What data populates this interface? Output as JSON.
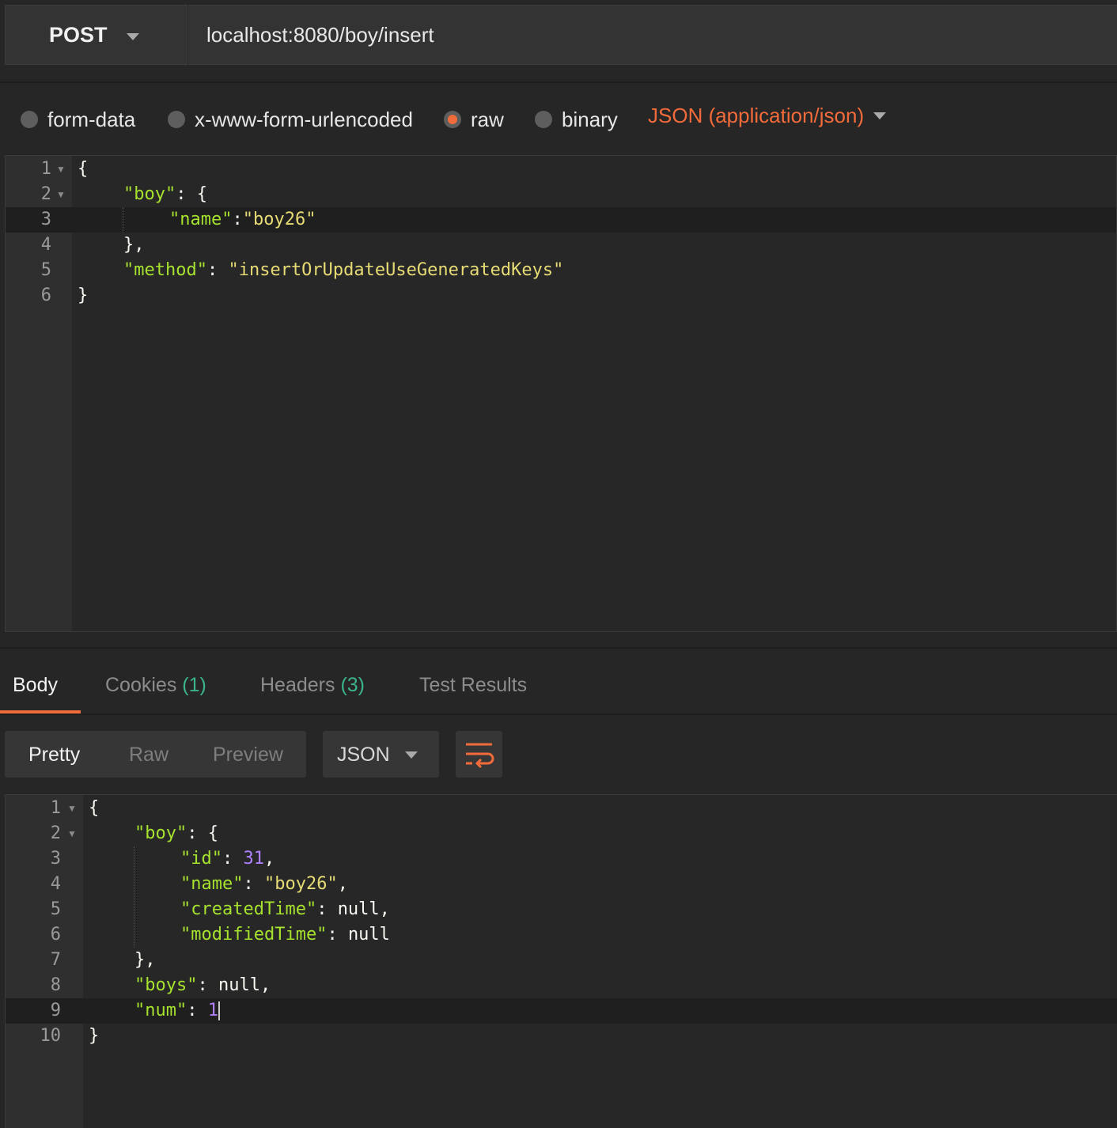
{
  "request": {
    "method": "POST",
    "url": "localhost:8080/boy/insert"
  },
  "body_types": {
    "form_data": "form-data",
    "urlencoded": "x-www-form-urlencoded",
    "raw": "raw",
    "binary": "binary",
    "selected": "raw",
    "content_type": "JSON (application/json)"
  },
  "request_body": {
    "line_numbers": [
      "1",
      "2",
      "3",
      "4",
      "5",
      "6"
    ],
    "boy_key": "\"boy\"",
    "name_key": "\"name\"",
    "name_value": "\"boy26\"",
    "method_key": "\"method\"",
    "method_value": "\"insertOrUpdateUseGeneratedKeys\""
  },
  "response_tabs": {
    "body": "Body",
    "cookies": "Cookies",
    "cookies_count": "(1)",
    "headers": "Headers",
    "headers_count": "(3)",
    "test_results": "Test Results",
    "active": "Body"
  },
  "view_modes": {
    "pretty": "Pretty",
    "raw": "Raw",
    "preview": "Preview",
    "active": "Pretty",
    "format": "JSON"
  },
  "response_body": {
    "line_numbers": [
      "1",
      "2",
      "3",
      "4",
      "5",
      "6",
      "7",
      "8",
      "9",
      "10"
    ],
    "boy_key": "\"boy\"",
    "id_key": "\"id\"",
    "id_value": "31",
    "name_key": "\"name\"",
    "name_value": "\"boy26\"",
    "created_key": "\"createdTime\"",
    "created_value": "null",
    "modified_key": "\"modifiedTime\"",
    "modified_value": "null",
    "boys_key": "\"boys\"",
    "boys_value": "null",
    "num_key": "\"num\"",
    "num_value": "1"
  },
  "colors": {
    "accent": "#f26b3a",
    "json_key": "#a6e22e",
    "json_string": "#e6db74",
    "json_number": "#ae81ff",
    "count_badge": "#3bb38d",
    "background": "#262626"
  },
  "icons": {
    "method_dropdown": "chevron-down-icon",
    "content_type_dropdown": "chevron-down-icon",
    "format_dropdown": "chevron-down-icon",
    "wrap": "wrap-lines-icon",
    "fold": "fold-arrow-icon"
  }
}
